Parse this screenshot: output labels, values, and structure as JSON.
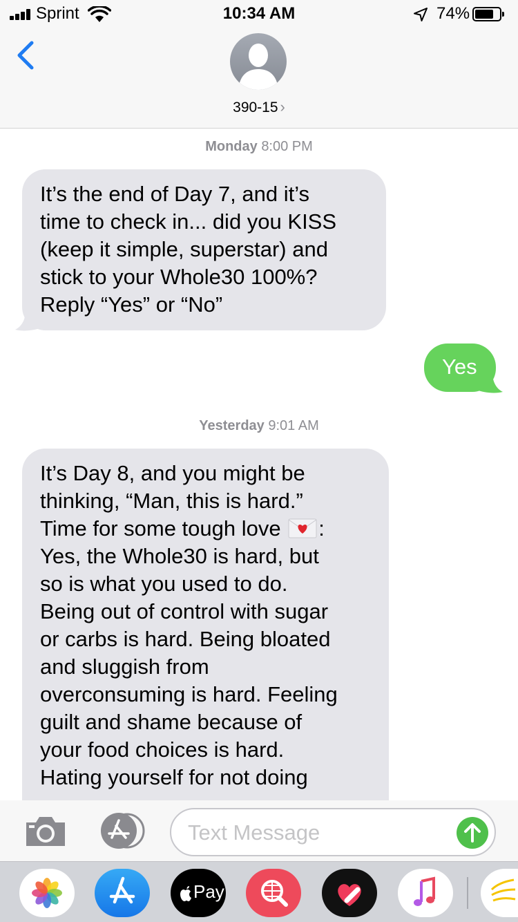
{
  "status_bar": {
    "carrier": "Sprint",
    "time": "10:34 AM",
    "battery_percent": "74%",
    "battery_level": 0.74,
    "icons": [
      "signal-icon",
      "wifi-icon",
      "location-arrow-icon",
      "battery-icon"
    ]
  },
  "header": {
    "contact_name": "390-15",
    "chevron": "›",
    "icons": [
      "back-chevron-icon",
      "contact-avatar-icon"
    ]
  },
  "conversation": {
    "timestamp_1": {
      "day": "Monday",
      "time": "8:00 PM"
    },
    "message_1": "It’s the end of Day 7, and it’s\ntime to check in... did you KISS\n(keep it simple, superstar) and\nstick to your Whole30 100%?\nReply “Yes” or “No”",
    "reply_1": "Yes",
    "timestamp_2": {
      "day": "Yesterday",
      "time": "9:01 AM"
    },
    "message_2_before_emoji": "It’s Day 8, and you might be\nthinking, “Man, this is hard.”\nTime for some tough love ",
    "message_2_after_emoji": ":\nYes, the Whole30 is hard, but\nso is what you used to do.\nBeing out of control with sugar\nor carbs is hard. Being bloated\nand sluggish from\noverconsuming is hard. Feeling\nguilt and shame because of\nyour food choices is hard.\nHating yourself for not doing",
    "emoji": "love-letter-icon"
  },
  "input_bar": {
    "placeholder": "Text Message",
    "icons": [
      "camera-icon",
      "app-store-icon",
      "send-arrow-icon"
    ]
  },
  "app_drawer": {
    "apple_pay_label": "Pay",
    "apps": [
      "photos-icon",
      "app-store-icon",
      "apple-pay-icon",
      "web-search-icon",
      "heart-app-icon",
      "music-icon",
      "sprint-icon"
    ]
  },
  "colors": {
    "incoming_bubble": "#e5e5ea",
    "outgoing_bubble": "#66d35c",
    "accent_blue": "#1f7cf2",
    "send_green": "#4fc04b"
  }
}
